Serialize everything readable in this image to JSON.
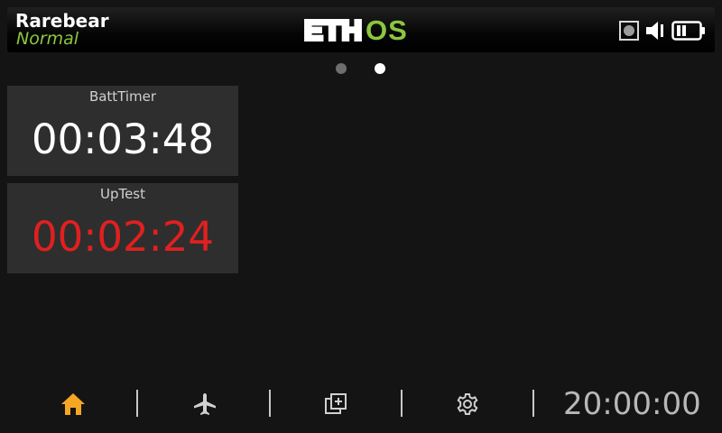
{
  "header": {
    "model_name": "Rarebear",
    "flight_mode": "Normal",
    "logo": {
      "prefix": "ETH",
      "suffix": "OS"
    },
    "status_icons": [
      "record-icon",
      "speaker-icon",
      "battery-icon"
    ]
  },
  "pager": {
    "page_count": 2,
    "active_page": 2
  },
  "widgets": [
    {
      "title": "BattTimer",
      "value": "00:03:48",
      "value_color": "#ffffff"
    },
    {
      "title": "UpTest",
      "value": "00:02:24",
      "value_color": "#e02020"
    }
  ],
  "navbar": {
    "buttons": [
      "home-icon",
      "airplane-icon",
      "system-icon",
      "settings-icon"
    ],
    "clock": "20:00:00"
  },
  "colors": {
    "accent_orange": "#f5a623",
    "mode_green": "#8cc63f",
    "logo_green": "#8cc63f",
    "alert_red": "#e02020"
  }
}
